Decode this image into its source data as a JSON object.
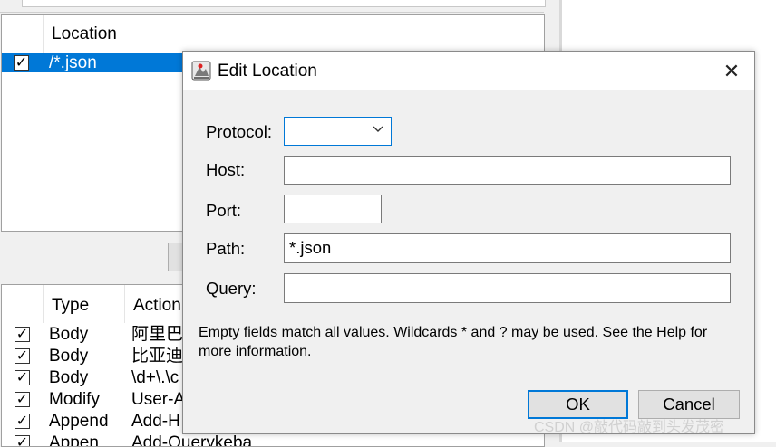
{
  "background_window": {
    "locations_table": {
      "header": "Location",
      "rows": [
        {
          "checked": true,
          "selected": true,
          "value": "/*.json"
        }
      ]
    },
    "rules_table": {
      "headers": {
        "type": "Type",
        "action": "Action"
      },
      "rows": [
        {
          "checked": true,
          "type": "Body",
          "action": "阿里巴"
        },
        {
          "checked": true,
          "type": "Body",
          "action": "比亚迪"
        },
        {
          "checked": true,
          "type": "Body",
          "action": "\\d+\\.\\c"
        },
        {
          "checked": true,
          "type": "Modify",
          "action": "User-A"
        },
        {
          "checked": true,
          "type": "Append",
          "action": "Add-H"
        },
        {
          "checked": true,
          "type": "Appen",
          "action": "Add-Querykeba"
        }
      ]
    }
  },
  "dialog": {
    "title": "Edit Location",
    "close_glyph": "✕",
    "fields": {
      "protocol": {
        "label": "Protocol:",
        "value": ""
      },
      "host": {
        "label": "Host:",
        "value": ""
      },
      "port": {
        "label": "Port:",
        "value": ""
      },
      "path": {
        "label": "Path:",
        "value": "*.json"
      },
      "query": {
        "label": "Query:",
        "value": ""
      }
    },
    "info": "Empty fields match all values. Wildcards * and ? may be used. See the Help for more information.",
    "ok_label": "OK",
    "cancel_label": "Cancel"
  },
  "watermark": "CSDN @敲代码敲到头发茂密",
  "icons": {
    "checkbox": "checkmark-icon",
    "dropdown": "chevron-down-icon",
    "app": "app-icon",
    "close": "close-icon"
  },
  "colors": {
    "selection": "#0078d7",
    "dialog_bg": "#f0f0f0",
    "focus_border": "#0078d7"
  }
}
